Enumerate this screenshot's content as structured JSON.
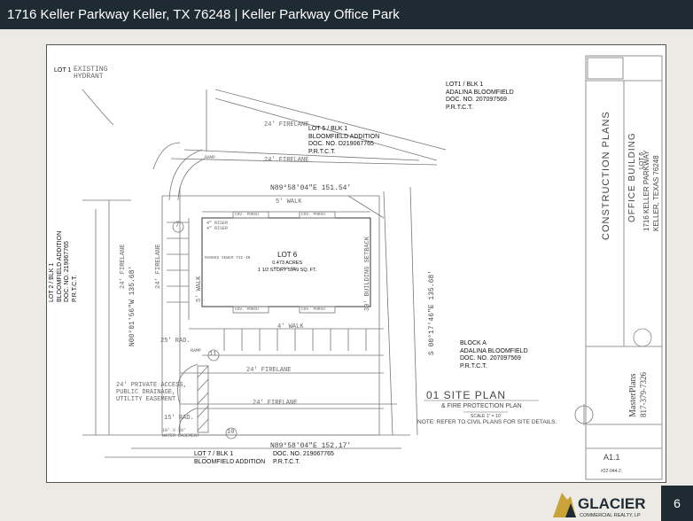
{
  "header": {
    "title": "1716 Keller Parkway Keller, TX 76248 | Keller Parkway Office Park"
  },
  "footer": {
    "page_number": "6",
    "brand": "GLACIER",
    "brand_sub": "COMMERCIAL REALTY, LP"
  },
  "lots": {
    "lot1": "LOT 1",
    "lot1_blk": [
      "LOT1 / BLK 1",
      "ADALINA BLOOMFIELD",
      "DOC. NO. 207097569",
      "P.R.T.C.T."
    ],
    "lot5": [
      "LOT 5 / BLK 1",
      "BLOOMFIELD ADDITION",
      "DOC. NO. D219067765",
      "P.R.T.C.T."
    ],
    "lot2": [
      "LOT 2 / BLK 1",
      "BLOOMFIELD ADDITION",
      "DOC. NO. 219067765",
      "P.R.T.C.T."
    ],
    "lot6": [
      "LOT 6",
      "0.473 ACRES",
      "1 1/2 STORY 5949 SQ. FT."
    ],
    "block_a": [
      "BLOCK A",
      "ADALINA BLOOMFIELD",
      "DOC. NO. 207097569",
      "P.R.T.C.T."
    ],
    "lot7": [
      "LOT 7 / BLK 1",
      "BLOOMFIELD ADDITION"
    ],
    "lot7_doc": [
      "DOC. NO. 219067765",
      "P.R.T.C.T."
    ]
  },
  "plan": {
    "existing_hydrant": [
      "EXISTING",
      "HYDRANT"
    ],
    "fire_lane_1": "24' FIRELANE",
    "fire_lane_2": "24' FIRELANE",
    "fire_lane_3": "24' FIRELANE",
    "fire_lane_4": "24' FIRELANE",
    "fire_lane_left": "24' FIRELANE",
    "fire_lane_left2": "24' FIRELANE",
    "north_line": "N89°58'04\"E 151.54'",
    "south_line": "N89°58'04\"E 152.17'",
    "west_line": "N00°01'56\"W 135.68'",
    "east_line": "S 00°17'46\"E 135.68'",
    "walk_top": "5' WALK",
    "walk_left": "5' WALK",
    "walk_bottom": "4' WALK",
    "setback": "30' BUILDING SETBACK",
    "access_easement": [
      "24' PRIVATE ACCESS,",
      "PUBLIC DRAINAGE,",
      "UTILITY EASEMENT"
    ],
    "rad_25": "25' RAD.",
    "rad_15": "15' RAD.",
    "water_easement": [
      "10' X 10'",
      "WATER EASEMENT"
    ],
    "ramp_top": "RAMP",
    "ramp_bottom": "RAMP",
    "cov_porch": "COV. PORCH",
    "riser": [
      "4\" RISER",
      "4\" RISER"
    ],
    "sewer": "MARKED SEWER TIE-IN",
    "ff": "FF 663.50",
    "parking_top": "7",
    "parking_mid": "11",
    "parking_bottom": "10"
  },
  "site_plan_title": "01 SITE PLAN",
  "site_plan_sub": "& FIRE PROTECTION PLAN",
  "scale": "SCALE 1\" = 10'",
  "note": "NOTE:  REFER TO CIVIL PLANS FOR SITE DETAILS.",
  "title_block": {
    "construction": "CONSTRUCTION PLANS",
    "office": "OFFICE BUILDING",
    "lot_line": "LOT 6",
    "street": "1716 KELLER PARKWAY",
    "city": "KELLER, TEXAS 76248",
    "firm": "MasterPlans",
    "phone": "817-379-7326",
    "sheet": "A1.1",
    "sheet_num": "#22-044-2"
  },
  "colors": {
    "header_bg": "#1f2b33",
    "footer_bg": "#eceae5",
    "plan_line": "#666666",
    "brand_gold": "#c9a23a"
  }
}
